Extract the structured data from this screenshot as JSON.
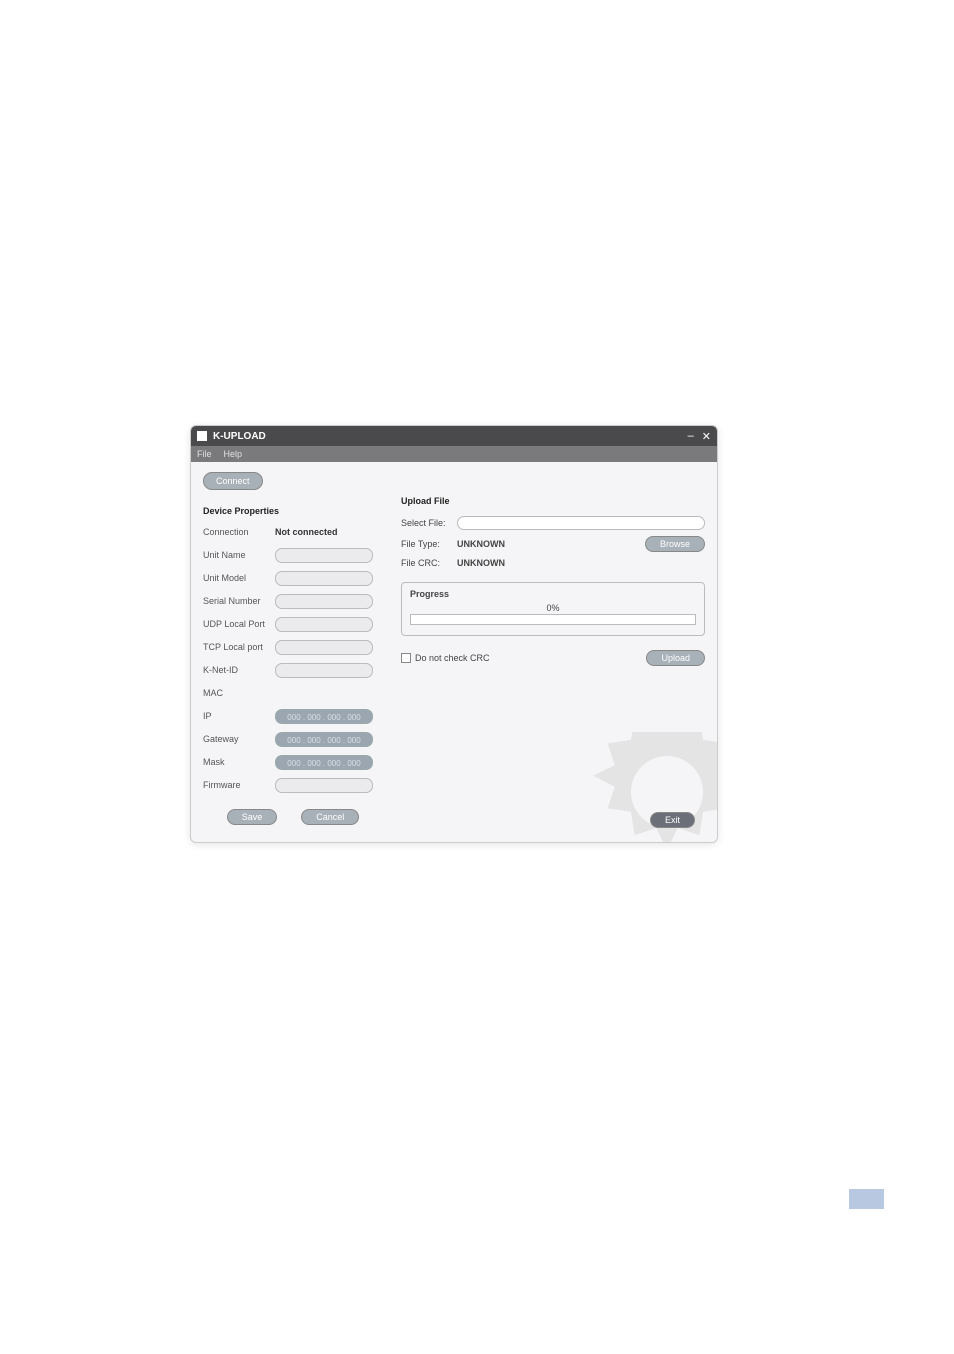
{
  "page": {
    "link_placeholder": " "
  },
  "window": {
    "title": "K-UPLOAD",
    "menu": {
      "file": "File",
      "help": "Help"
    },
    "connect_btn": "Connect"
  },
  "device_props": {
    "heading": "Device Properties",
    "connection": {
      "label": "Connection",
      "value": "Not connected"
    },
    "unit_name": {
      "label": "Unit Name"
    },
    "unit_model": {
      "label": "Unit Model"
    },
    "serial": {
      "label": "Serial Number"
    },
    "udp_port": {
      "label": "UDP Local Port"
    },
    "tcp_port": {
      "label": "TCP Local port"
    },
    "knet_id": {
      "label": "K-Net-ID"
    },
    "mac": {
      "label": "MAC"
    },
    "ip": {
      "label": "IP",
      "value": "000 . 000 . 000 . 000"
    },
    "gateway": {
      "label": "Gateway",
      "value": "000 . 000 . 000 . 000"
    },
    "mask": {
      "label": "Mask",
      "value": "000 . 000 . 000 . 000"
    },
    "firmware": {
      "label": "Firmware"
    },
    "save_btn": "Save",
    "cancel_btn": "Cancel"
  },
  "upload": {
    "heading": "Upload File",
    "select_file": "Select File:",
    "file_type_label": "File Type:",
    "file_type_value": "UNKNOWN",
    "file_crc_label": "File CRC:",
    "file_crc_value": "UNKNOWN",
    "browse_btn": "Browse",
    "progress_label": "Progress",
    "progress_pct": "0%",
    "no_crc_label": "Do not check CRC",
    "upload_btn": "Upload",
    "exit_btn": "Exit"
  }
}
